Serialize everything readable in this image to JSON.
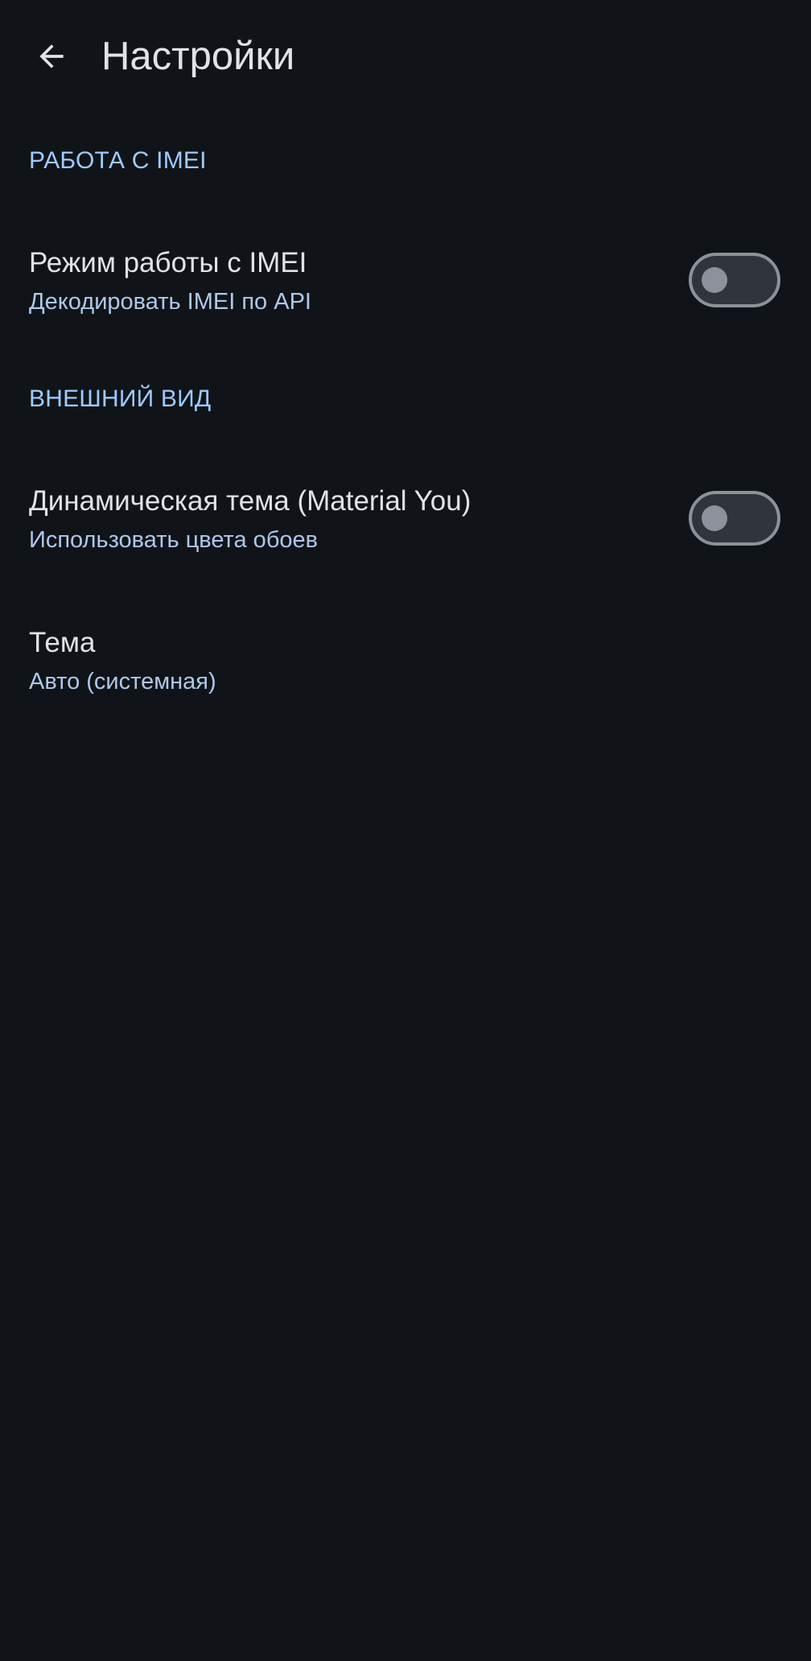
{
  "app_bar": {
    "title": "Настройки",
    "back_icon": "arrow-back-icon"
  },
  "sections": [
    {
      "header": "РАБОТА С IMEI",
      "items": [
        {
          "title": "Режим работы с IMEI",
          "summary": "Декодировать IMEI по API",
          "switch_on": false
        }
      ]
    },
    {
      "header": "ВНЕШНИЙ ВИД",
      "items": [
        {
          "title": "Динамическая тема (Material You)",
          "summary": "Использовать цвета обоев",
          "switch_on": false
        },
        {
          "title": "Тема",
          "summary": "Авто (системная)"
        }
      ]
    }
  ],
  "colors": {
    "background": "#101418",
    "accent": "#9ecaff",
    "summary": "#aec8ec",
    "text": "#e2e2e6",
    "switch_outline": "#8d9199",
    "switch_track": "#30343b"
  }
}
